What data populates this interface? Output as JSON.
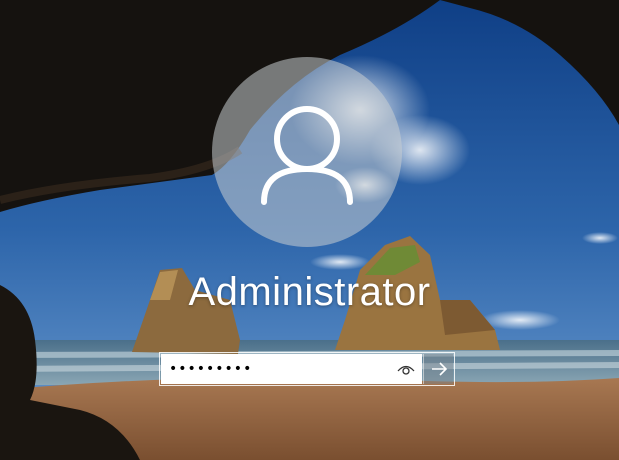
{
  "user": {
    "name": "Administrator"
  },
  "password_field": {
    "value": "•••••••••",
    "placeholder": ""
  },
  "icons": {
    "avatar": "user-silhouette-icon",
    "reveal": "eye-icon",
    "submit": "arrow-right-icon"
  },
  "colors": {
    "sky": "#1f4f8e",
    "sand": "#9a6a45",
    "text": "#ffffff"
  }
}
